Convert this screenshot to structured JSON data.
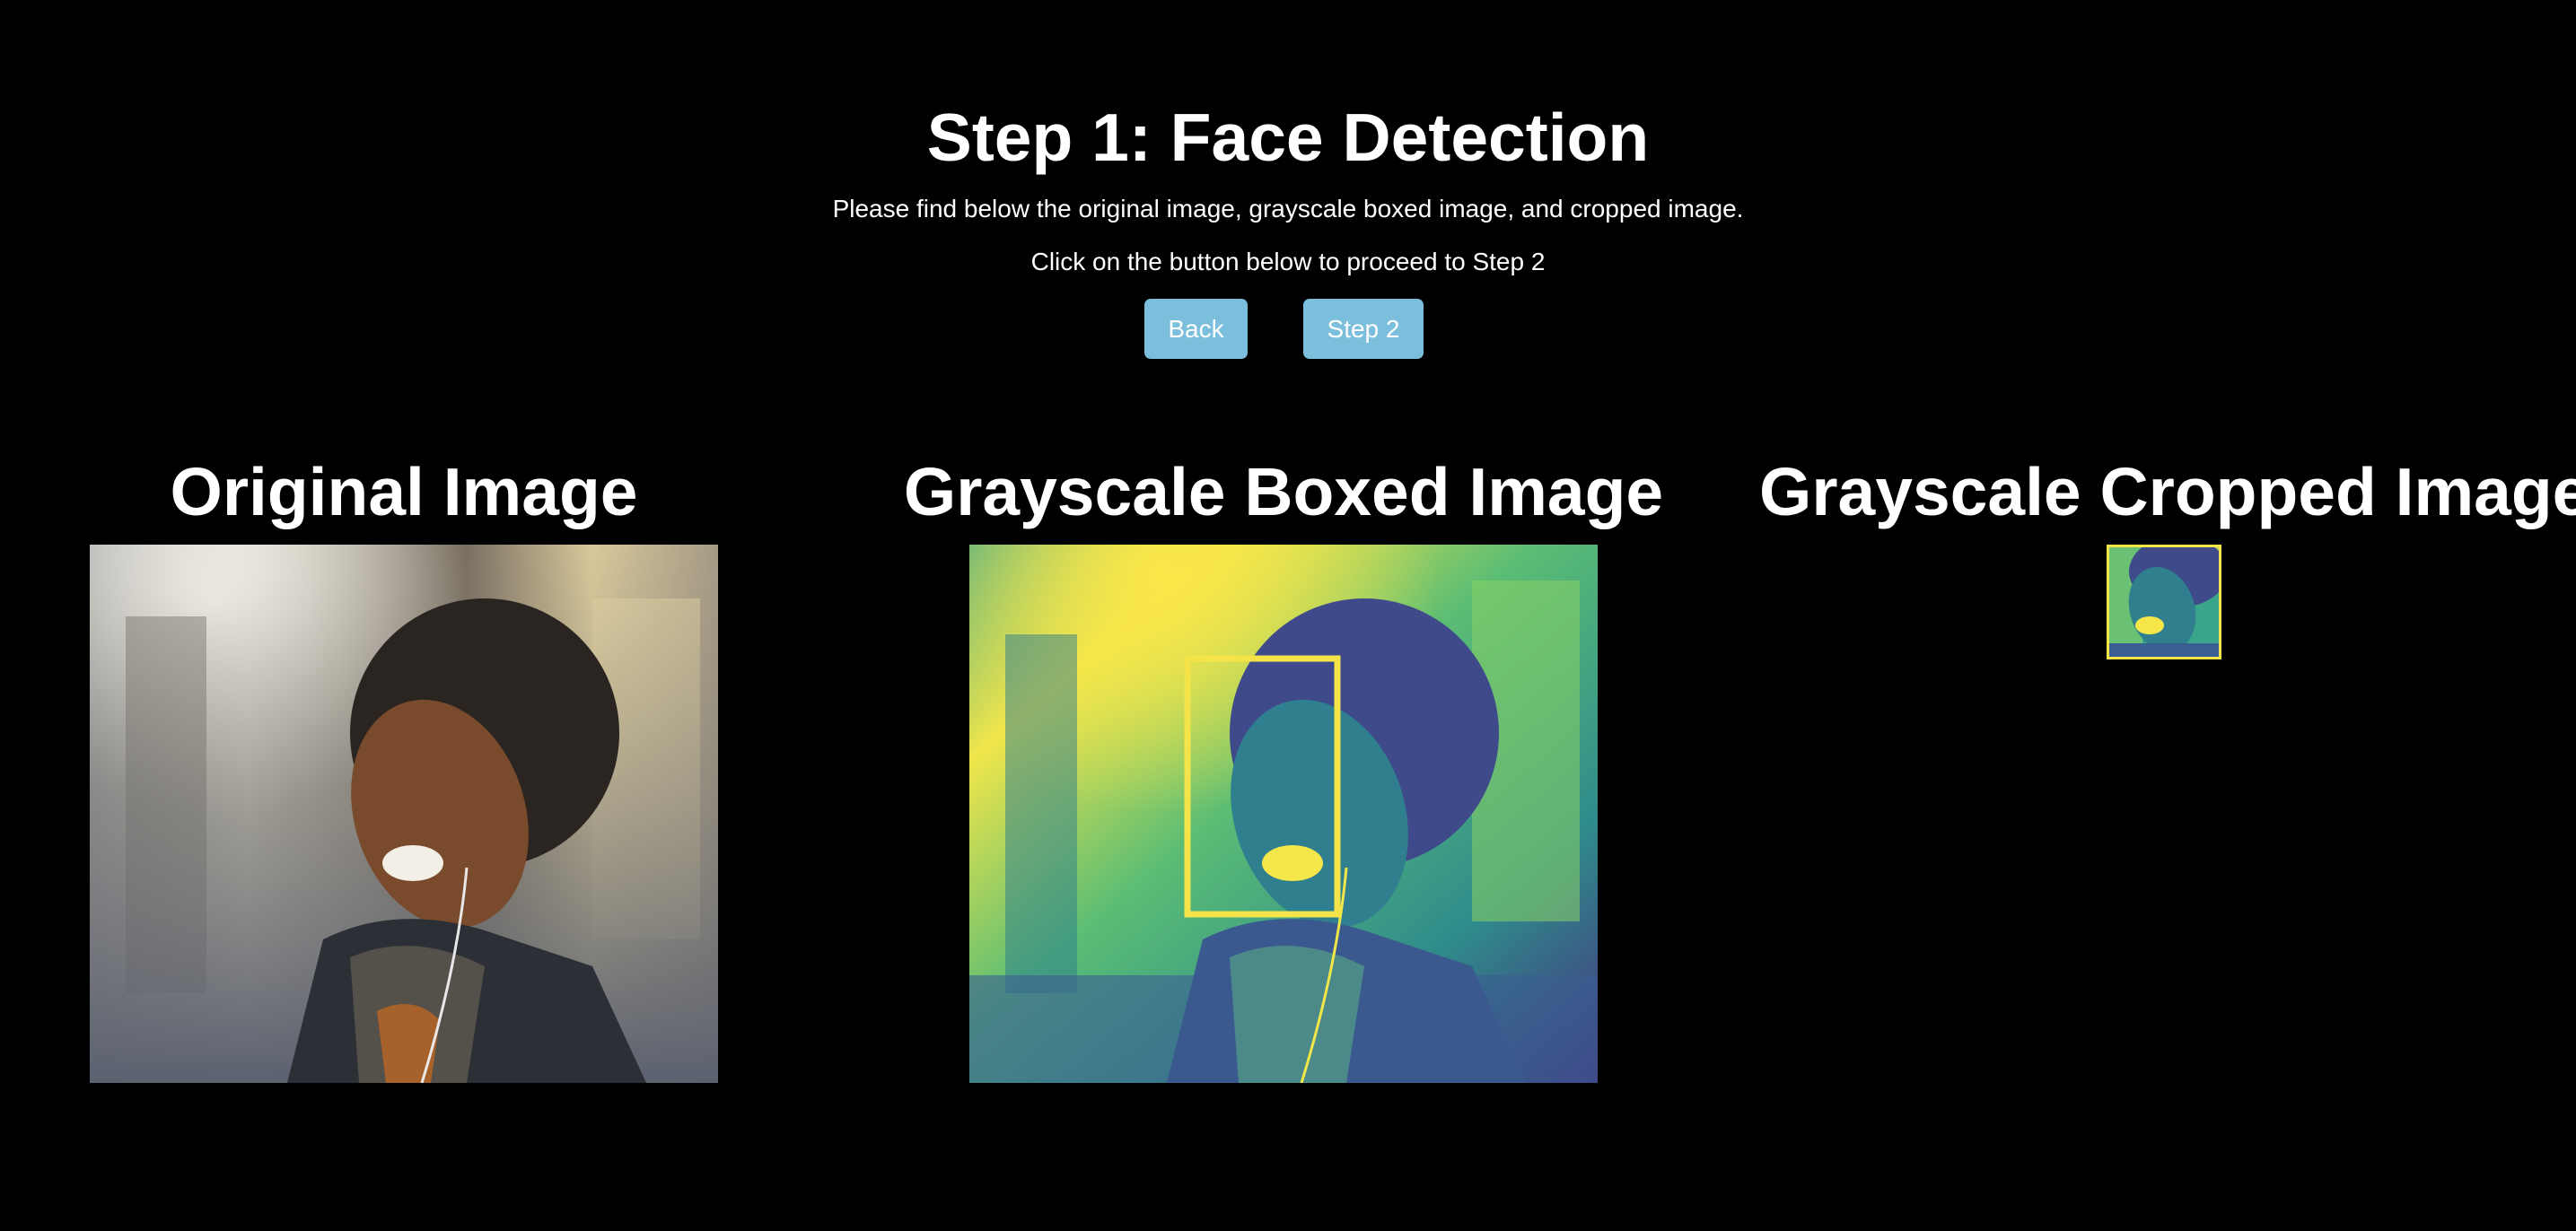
{
  "header": {
    "title": "Step 1: Face Detection",
    "subtitle": "Please find below the original image, grayscale boxed image, and cropped image.",
    "instruction": "Click on the button below to proceed to Step 2"
  },
  "buttons": {
    "back_label": "Back",
    "step2_label": "Step 2",
    "color": "#7bbfdc"
  },
  "columns": {
    "original_title": "Original Image",
    "boxed_title": "Grayscale Boxed Image",
    "cropped_title": "Grayscale Cropped Image"
  },
  "colors": {
    "background": "#000000",
    "text": "#ffffff",
    "viridis_yellow": "#f0e64a",
    "viridis_green": "#3aa58a",
    "viridis_blue": "#3b5e92",
    "viridis_purple": "#46317e"
  }
}
